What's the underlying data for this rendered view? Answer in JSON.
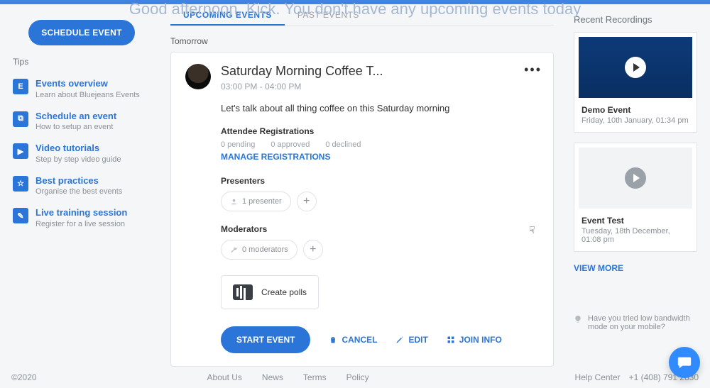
{
  "greeting": "Good afternoon, Kick. You don't have any upcoming events today",
  "sidebar": {
    "schedule_btn": "SCHEDULE EVENT",
    "tips_heading": "Tips",
    "tips": [
      {
        "icon": "E",
        "title": "Events overview",
        "sub": "Learn about Bluejeans Events"
      },
      {
        "icon": "⧉",
        "title": "Schedule an event",
        "sub": "How to setup an event"
      },
      {
        "icon": "▶",
        "title": "Video tutorials",
        "sub": "Step by step video guide"
      },
      {
        "icon": "☆",
        "title": "Best practices",
        "sub": "Organise the best events"
      },
      {
        "icon": "✎",
        "title": "Live training session",
        "sub": "Register for a live session"
      }
    ]
  },
  "tabs": {
    "upcoming": "UPCOMING EVENTS",
    "past": "PAST EVENTS"
  },
  "section_tomorrow": "Tomorrow",
  "event": {
    "title": "Saturday Morning Coffee T...",
    "time": "03:00 PM - 04:00 PM",
    "desc": "Let's talk about all thing coffee on this Saturday morning",
    "registrations_head": "Attendee Registrations",
    "pending": "0 pending",
    "approved": "0 approved",
    "declined": "0 declined",
    "manage": "MANAGE REGISTRATIONS",
    "presenters_head": "Presenters",
    "presenters_chip": "1 presenter",
    "moderators_head": "Moderators",
    "moderators_chip": "0 moderators",
    "poll": "Create polls",
    "start": "START EVENT",
    "cancel": "CANCEL",
    "edit": "EDIT",
    "join": "JOIN INFO"
  },
  "right": {
    "head": "Recent Recordings",
    "items": [
      {
        "title": "Demo Event",
        "sub": "Friday, 10th January, 01:34 pm"
      },
      {
        "title": "Event Test",
        "sub": "Tuesday, 18th December, 01:08 pm"
      }
    ],
    "view_more": "VIEW MORE",
    "hint": "Have you tried low bandwidth mode on your mobile?"
  },
  "footer": {
    "copyright": "©2020",
    "links": [
      "About Us",
      "News",
      "Terms",
      "Policy"
    ],
    "help": "Help Center",
    "phone": "+1 (408) 791 2830"
  }
}
